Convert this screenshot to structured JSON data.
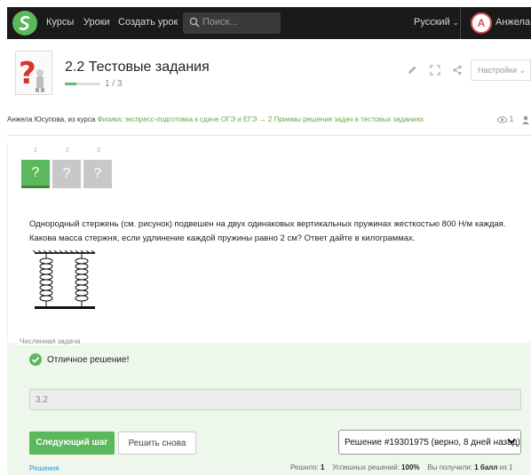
{
  "nav": {
    "links": [
      "Курсы",
      "Уроки",
      "Создать урок"
    ],
    "search_placeholder": "Поиск...",
    "language": "Русский",
    "user_initial": "А",
    "user_name": "Анжела"
  },
  "lesson": {
    "title": "2.2 Тестовые задания",
    "progress_text": "1 / 3",
    "progress_fraction": 0.33,
    "settings_label": "Настройки"
  },
  "breadcrumb": {
    "author": "Анжела Юсупова",
    "prefix": ", из курса ",
    "course_link": "Физика: экспресс-подготовка к сдаче ОГЭ и ЕГЭ → 2 Приемы решения задач в тестовых заданиях",
    "views": "1"
  },
  "steps": [
    {
      "number": "1",
      "mark": "?",
      "state": "active"
    },
    {
      "number": "2",
      "mark": "?",
      "state": "todo"
    },
    {
      "number": "3",
      "mark": "?",
      "state": "todo"
    }
  ],
  "question": {
    "line1": "Однородный стержень (см. рисунок) подвешен на двух одинаковых вертикальных пружинах жесткостью 800 Н/м каждая.",
    "line2": "Какова масса стержня, если удлинение каждой пружины равно 2 см? Ответ дайте в килограммах."
  },
  "result": {
    "task_type": "Численная задача",
    "status": "Отличное решение!",
    "answer_value": "3,2",
    "next_button": "Следующий шаг",
    "retry_button": "Решить снова",
    "solution_select": "Решение #19301975 (верно, 8 дней назад)"
  },
  "footer": {
    "solutions_link": "Решения",
    "solved_label": "Решило:",
    "solved_value": "1",
    "success_label": "Успешных решений:",
    "success_value": "100%",
    "got_label": "Вы получили:",
    "got_value": "1 балл",
    "got_suffix": "из 1"
  },
  "colors": {
    "accent_green": "#5cb85c",
    "nav_bg": "#1a1a1a",
    "success_bg": "#edf7ec",
    "avatar_red": "#d9534f"
  }
}
